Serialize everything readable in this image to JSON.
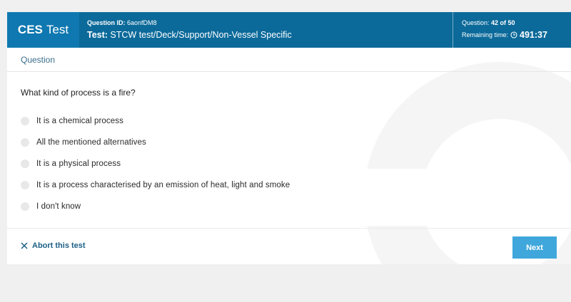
{
  "header": {
    "brand_bold": "CES",
    "brand_light": "Test",
    "question_id_label": "Question ID:",
    "question_id_value": "6aonfDM8",
    "test_label": "Test:",
    "test_value": "STCW test/Deck/Support/Non-Vessel Specific",
    "question_label": "Question:",
    "question_value": "42 of 50",
    "remaining_label": "Remaining time:",
    "remaining_value": "491:37"
  },
  "section": {
    "title": "Question"
  },
  "question": {
    "text": "What kind of process is a fire?",
    "options": [
      "It is a chemical process",
      "All the mentioned alternatives",
      "It is a physical process",
      "It is a process characterised by an emission of heat, light and smoke",
      "I don't know"
    ]
  },
  "footer": {
    "abort_label": "Abort this test",
    "next_label": "Next"
  },
  "colors": {
    "header_bg": "#0c6a9a",
    "brand_bg": "#0f78b0",
    "next_button": "#3fa7dc",
    "abort_link": "#1b5f86"
  }
}
